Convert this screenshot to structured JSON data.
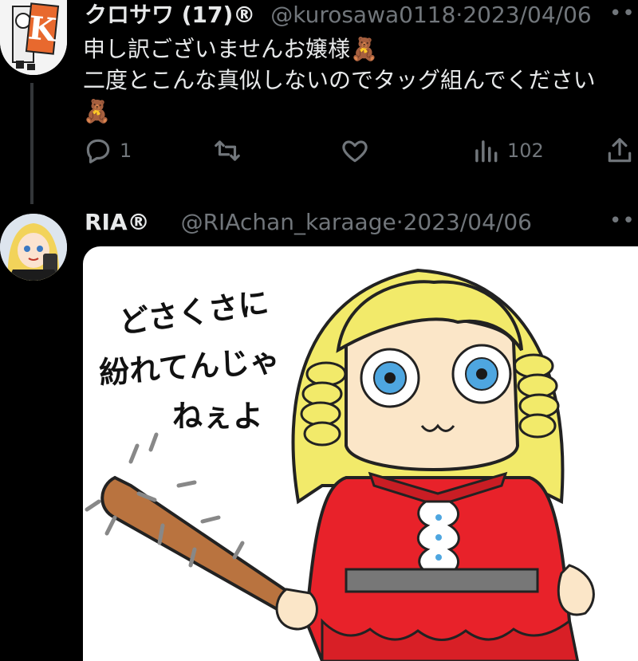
{
  "tweets": [
    {
      "display_name": "クロサワ (17)®",
      "handle": "@kurosawa0118",
      "separator": "·",
      "date": "2023/04/06",
      "text_lines": [
        "申し訳ございませんお嬢様🧸",
        "二度とこんな真似しないのでタッグ組んでください",
        "🧸"
      ],
      "avatar_letter": "K",
      "actions": {
        "reply_count": "1",
        "retweet_count": "",
        "like_count": "",
        "views_count": "102"
      },
      "more_label": "•••"
    },
    {
      "display_name": "RIA®",
      "handle": "@RIAchan_karaage",
      "separator": "·",
      "date": "2023/04/06",
      "more_label": "•••",
      "image_caption_lines": [
        "どさくさに",
        "紛れてんじゃ",
        "ねぇよ"
      ]
    }
  ],
  "colors": {
    "background": "#000000",
    "text": "#e7e9ea",
    "secondary": "#71767b",
    "thread_line": "#333639",
    "hair": "#f2ea6a",
    "dress": "#e8222a",
    "bat": "#b9733f"
  },
  "icons": [
    "reply-icon",
    "retweet-icon",
    "like-icon",
    "views-icon",
    "share-icon",
    "more-icon"
  ]
}
